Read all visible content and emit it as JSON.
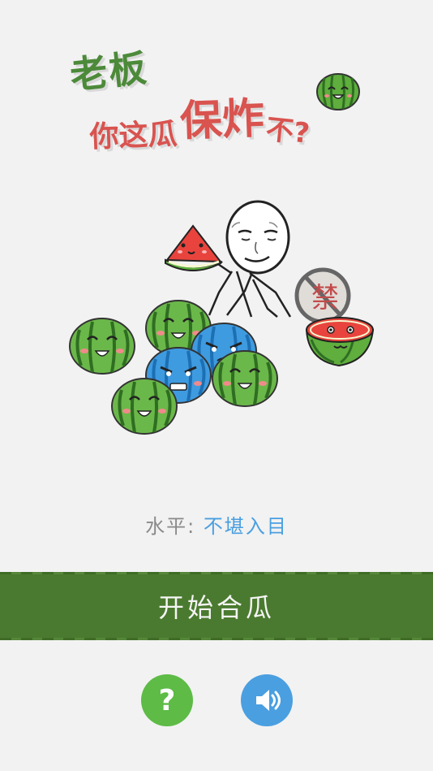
{
  "title": {
    "line1": "老板",
    "line2_part1": "你这瓜",
    "line2_part2": "保炸",
    "line2_part3": "不?"
  },
  "illustration": {
    "ban_sign_text": "禁"
  },
  "level": {
    "label": "水平:",
    "value": "不堪入目"
  },
  "start_button": {
    "label": "开始合瓜"
  },
  "help_button": {
    "glyph": "?"
  },
  "colors": {
    "background": "#f2f2f2",
    "band_green": "#4a7a2f",
    "title_green": "#4c8a3a",
    "title_red": "#d9534f",
    "help_green": "#5dbb46",
    "sound_blue": "#4a9fe0",
    "level_gray": "#8a8a8a",
    "level_blue": "#4a9fe0"
  }
}
